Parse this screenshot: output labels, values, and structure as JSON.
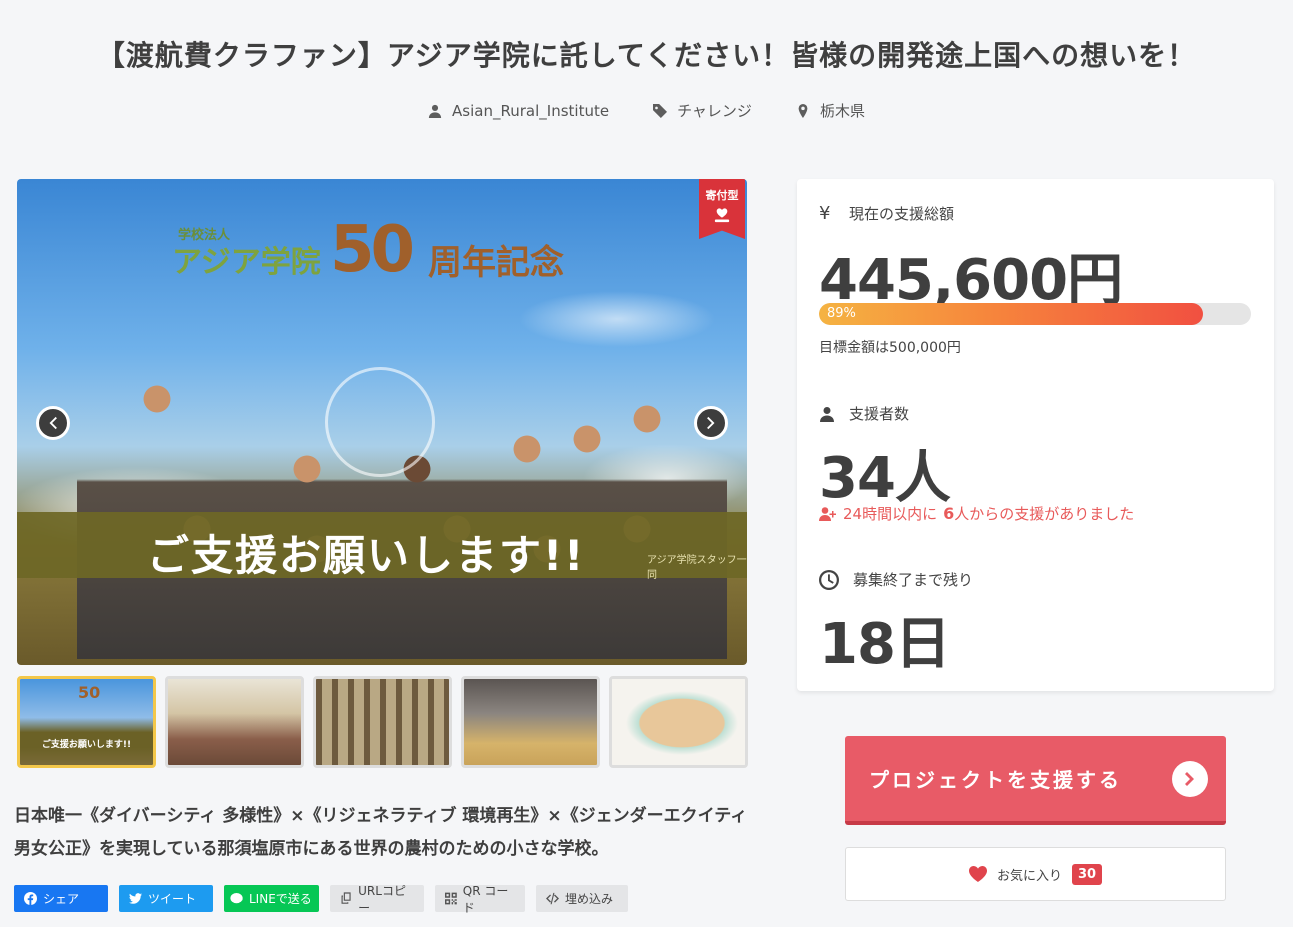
{
  "project": {
    "title": "【渡航費クラファン】アジア学院に託してください！皆様の開発途上国への想いを！",
    "owner": "Asian_Rural_Institute",
    "category": "チャレンジ",
    "location": "栃木県"
  },
  "main_image": {
    "logo_small": "学校法人",
    "logo_big": "アジア学院",
    "anniversary_number": "50",
    "anniversary_text": "周年記念",
    "banner_text": "ご支援お願いします!!",
    "banner_credit": "アジア学院スタッフ一同",
    "badge": "寄付型"
  },
  "thumbnails": [
    {
      "name": "thumbnail-1",
      "caption": "ご支援お願いします!!",
      "num": "50",
      "active": true
    },
    {
      "name": "thumbnail-2",
      "active": false
    },
    {
      "name": "thumbnail-3",
      "active": false
    },
    {
      "name": "thumbnail-4",
      "active": false
    },
    {
      "name": "thumbnail-5",
      "active": false
    }
  ],
  "description": "日本唯一《ダイバーシティ 多様性》×《リジェネラティブ 環境再生》×《ジェンダーエクイティ 男女公正》を実現している那須塩原市にある世界の農村のための小さな学校。",
  "share": {
    "facebook": "シェア",
    "twitter": "ツイート",
    "line": "LINEで送る",
    "url_copy": "URLコピー",
    "qr": "QR コード",
    "embed": "埋め込み"
  },
  "stats": {
    "total_label": "現在の支援総額",
    "total_icon": "¥",
    "total_value": "445,600円",
    "progress_percent": 89,
    "progress_text": "89%",
    "goal_text": "目標金額は500,000円",
    "supporters_label": "支援者数",
    "supporters_value": "34人",
    "recent_prefix": "24時間以内に",
    "recent_count": "6",
    "recent_suffix": "人からの支援がありました",
    "remaining_label": "募集終了まで残り",
    "remaining_value": "18日"
  },
  "actions": {
    "support_label": "プロジェクトを支援する",
    "favorite_label": "お気に入り",
    "favorite_count": "30"
  },
  "colors": {
    "support_button": "#e85b67",
    "progress_start": "#f5b342",
    "progress_end": "#f15041",
    "accent_red": "#e0444c"
  }
}
